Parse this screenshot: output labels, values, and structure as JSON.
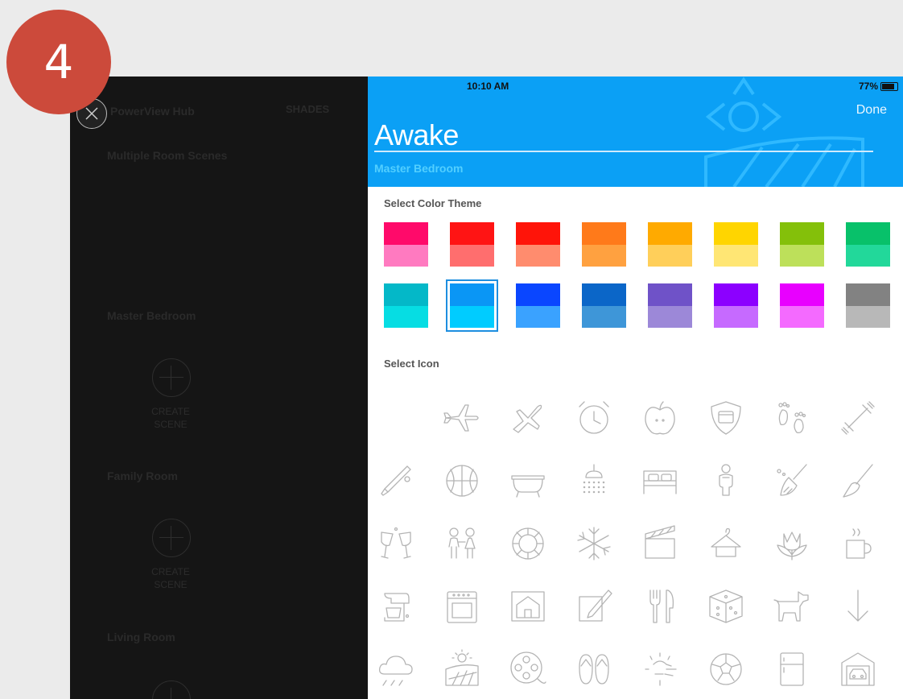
{
  "step_badge": "4",
  "sidebar": {
    "hub_title": "PowerView Hub",
    "tab_shades": "SHADES",
    "sections": [
      "Multiple Room Scenes",
      "Master Bedroom",
      "Family Room",
      "Living Room"
    ],
    "create_scene_label": "CREATE SCENE"
  },
  "status_bar": {
    "time": "10:10 AM",
    "battery": "77%"
  },
  "header": {
    "done_label": "Done",
    "scene_name": "Awake",
    "room": "Master Bedroom"
  },
  "color_theme": {
    "label": "Select Color Theme",
    "selected_index": 9,
    "swatches": [
      {
        "top": "#ff0a6a",
        "bottom": "#ff7ac0"
      },
      {
        "top": "#ff1414",
        "bottom": "#ff6e6e"
      },
      {
        "top": "#ff1409",
        "bottom": "#ff8c6e"
      },
      {
        "top": "#ff7a1a",
        "bottom": "#ffa140"
      },
      {
        "top": "#ffaa00",
        "bottom": "#ffcf5a"
      },
      {
        "top": "#ffd500",
        "bottom": "#ffe674"
      },
      {
        "top": "#84c00a",
        "bottom": "#bde05a"
      },
      {
        "top": "#08c16a",
        "bottom": "#22d89a"
      },
      {
        "top": "#04b8c8",
        "bottom": "#06dde3"
      },
      {
        "top": "#0a96f5",
        "bottom": "#00ccff"
      },
      {
        "top": "#0a46ff",
        "bottom": "#3aa2ff"
      },
      {
        "top": "#0b66c8",
        "bottom": "#3e96d8"
      },
      {
        "top": "#6f52c8",
        "bottom": "#9c88d8"
      },
      {
        "top": "#8c00ff",
        "bottom": "#c66aff"
      },
      {
        "top": "#e800ff",
        "bottom": "#f46aff"
      },
      {
        "top": "#828282",
        "bottom": "#b8b8b8"
      }
    ]
  },
  "icons": {
    "label": "Select Icon",
    "names": [
      "blank-icon",
      "airplane-icon",
      "airplane-takeoff-icon",
      "alarm-clock-icon",
      "apple-icon",
      "shield-icon",
      "footprints-icon",
      "dumbbell-icon",
      "baseball-bat-icon",
      "basketball-icon",
      "bathtub-icon",
      "shower-icon",
      "bed-icon",
      "baby-icon",
      "broom-icon",
      "paintbrush-icon",
      "champagne-glasses-icon",
      "kids-icon",
      "poker-chip-icon",
      "snowflake-icon",
      "clapperboard-icon",
      "coat-hanger-icon",
      "tulip-icon",
      "coffee-mug-icon",
      "stand-mixer-icon",
      "oven-icon",
      "house-icon",
      "notepad-pencil-icon",
      "fork-knife-icon",
      "dice-icon",
      "dog-icon",
      "arrow-down-icon",
      "rain-cloud-icon",
      "sunrise-field-icon",
      "film-reel-icon",
      "flip-flops-icon",
      "sun-glare-icon",
      "soccer-ball-icon",
      "refrigerator-icon",
      "garage-car-icon"
    ]
  }
}
